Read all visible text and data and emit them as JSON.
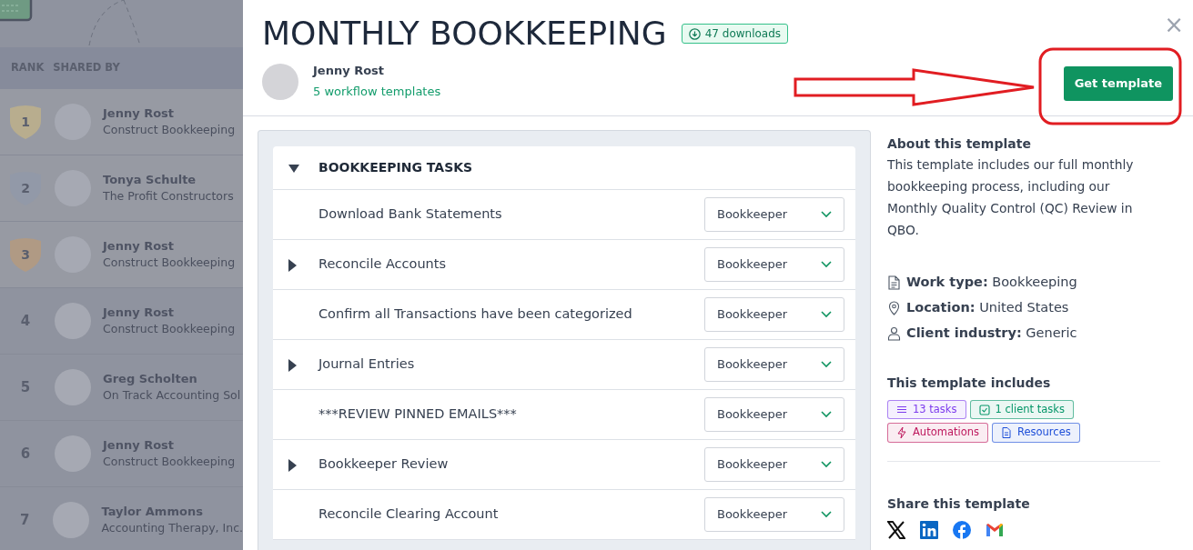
{
  "background_list": {
    "columns": [
      "RANK",
      "SHARED BY"
    ],
    "rows": [
      {
        "rank": "1",
        "kind": "medal",
        "color": "#b8ad8e",
        "name": "Jenny Rost",
        "company": "Construct Bookkeeping"
      },
      {
        "rank": "2",
        "kind": "medal",
        "color": "#9299a8",
        "name": "Tonya Schulte",
        "company": "The Profit Constructors"
      },
      {
        "rank": "3",
        "kind": "medal",
        "color": "#b09a84",
        "name": "Jenny Rost",
        "company": "Construct Bookkeeping"
      },
      {
        "rank": "4",
        "kind": "plain",
        "name": "Jenny Rost",
        "company": "Construct Bookkeeping"
      },
      {
        "rank": "5",
        "kind": "plain",
        "name": "Greg Scholten",
        "company": "On Track Accounting Sol"
      },
      {
        "rank": "6",
        "kind": "plain",
        "name": "Jenny Rost",
        "company": "Construct Bookkeeping"
      },
      {
        "rank": "7",
        "kind": "plain",
        "name": "Taylor Ammons",
        "company": "Accounting Therapy, Inc."
      }
    ]
  },
  "modal": {
    "title": "MONTHLY BOOKKEEPING",
    "downloads": "47 downloads",
    "close": "×",
    "author": {
      "name": "Jenny Rost",
      "templates_link": "5 workflow templates"
    },
    "get_button": "Get template",
    "section": {
      "title": "BOOKKEEPING TASKS",
      "expanded": true,
      "tasks": [
        {
          "kind": "task",
          "label": "Download Bank Statements",
          "assignee": "Bookkeeper"
        },
        {
          "kind": "group",
          "label": "Reconcile Accounts",
          "assignee": "Bookkeeper"
        },
        {
          "kind": "task",
          "label": "Confirm all Transactions have been categorized",
          "assignee": "Bookkeeper"
        },
        {
          "kind": "group",
          "label": "Journal Entries",
          "assignee": "Bookkeeper"
        },
        {
          "kind": "task",
          "label": "***REVIEW PINNED EMAILS***",
          "assignee": "Bookkeeper"
        },
        {
          "kind": "group",
          "label": "Bookkeeper Review",
          "assignee": "Bookkeeper"
        },
        {
          "kind": "task",
          "label": "Reconcile Clearing Account",
          "assignee": "Bookkeeper"
        }
      ]
    },
    "about": {
      "heading": "About this template",
      "text": "This template includes our full monthly bookkeeping process, including our Monthly Quality Control (QC) Review in QBO."
    },
    "details": [
      {
        "kind": "document",
        "text": "**Work type:** Bookkeeping"
      },
      {
        "kind": "location",
        "text": "**Location:** United States"
      },
      {
        "kind": "person",
        "text": "**Client industry:** Generic"
      }
    ],
    "includes": {
      "heading": "This template includes",
      "tags": [
        {
          "kind": "list",
          "label": "13 tasks",
          "color": "#7c3aed"
        },
        {
          "kind": "check",
          "label": "1 client tasks",
          "color": "#059669"
        },
        {
          "kind": "bolt",
          "label": "Automations",
          "color": "#be185d"
        },
        {
          "kind": "document",
          "label": "Resources",
          "color": "#1d4ed8"
        }
      ]
    },
    "share": {
      "heading": "Share this template",
      "networks": [
        {
          "kind": "x"
        },
        {
          "kind": "linkedin"
        },
        {
          "kind": "facebook"
        },
        {
          "kind": "gmail"
        }
      ]
    }
  }
}
